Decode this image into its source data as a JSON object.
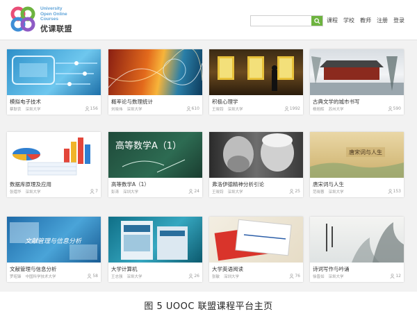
{
  "header": {
    "logo_en": [
      "University",
      "Open Online",
      "Courses"
    ],
    "logo_cn": "优课联盟",
    "search": {
      "placeholder": ""
    },
    "nav": [
      "课程",
      "学校",
      "教师",
      "注册",
      "登录"
    ]
  },
  "courses": [
    {
      "title": "模拟电子技术",
      "teacher": "蔡耿农",
      "school": "深圳大学",
      "count": "156",
      "thumb": "circuit"
    },
    {
      "title": "概率论与数理统计",
      "teacher": "刘晓伟",
      "school": "深圳大学",
      "count": "610",
      "thumb": "probability"
    },
    {
      "title": "积极心理学",
      "teacher": "王晓钧",
      "school": "深圳大学",
      "count": "1992",
      "thumb": "gallery"
    },
    {
      "title": "古典文学的城市书写",
      "teacher": "杨旭辉",
      "school": "苏州大学",
      "count": "590",
      "thumb": "snow"
    },
    {
      "title": "数据库原理及应用",
      "teacher": "张熠华",
      "school": "深圳大学",
      "count": "7",
      "thumb": "database"
    },
    {
      "title": "高等数学A（1）",
      "teacher": "彭涛",
      "school": "深圳大学",
      "count": "24",
      "thumb": "blackboard",
      "thumb_text": "高等数学A（1）"
    },
    {
      "title": "弗洛伊德精神分析引论",
      "teacher": "王晓钧",
      "school": "深圳大学",
      "count": "25",
      "thumb": "portrait"
    },
    {
      "title": "唐宋词与人生",
      "teacher": "范晓蓉",
      "school": "深圳大学",
      "count": "153",
      "thumb": "scroll",
      "thumb_text": "唐宋词与人生"
    },
    {
      "title": "文献管理与信息分析",
      "teacher": "罗昭锋",
      "school": "中国科学技术大学",
      "count": "58",
      "thumb": "literature",
      "thumb_text": "文献管理与信息分析"
    },
    {
      "title": "大学计算机",
      "teacher": "王志强",
      "school": "深圳大学",
      "count": "26",
      "thumb": "books"
    },
    {
      "title": "大学英语阅读",
      "teacher": "张敏",
      "school": "深圳大学",
      "count": "76",
      "thumb": "notebook"
    },
    {
      "title": "诗词写作与吟诵",
      "teacher": "徐晋如",
      "school": "深圳大学",
      "count": "12",
      "thumb": "ink"
    }
  ],
  "caption": "图 5  UOOC 联盟课程平台主页",
  "colors": {
    "accent_green": "#6db33f",
    "background": "#f2f2f2"
  }
}
